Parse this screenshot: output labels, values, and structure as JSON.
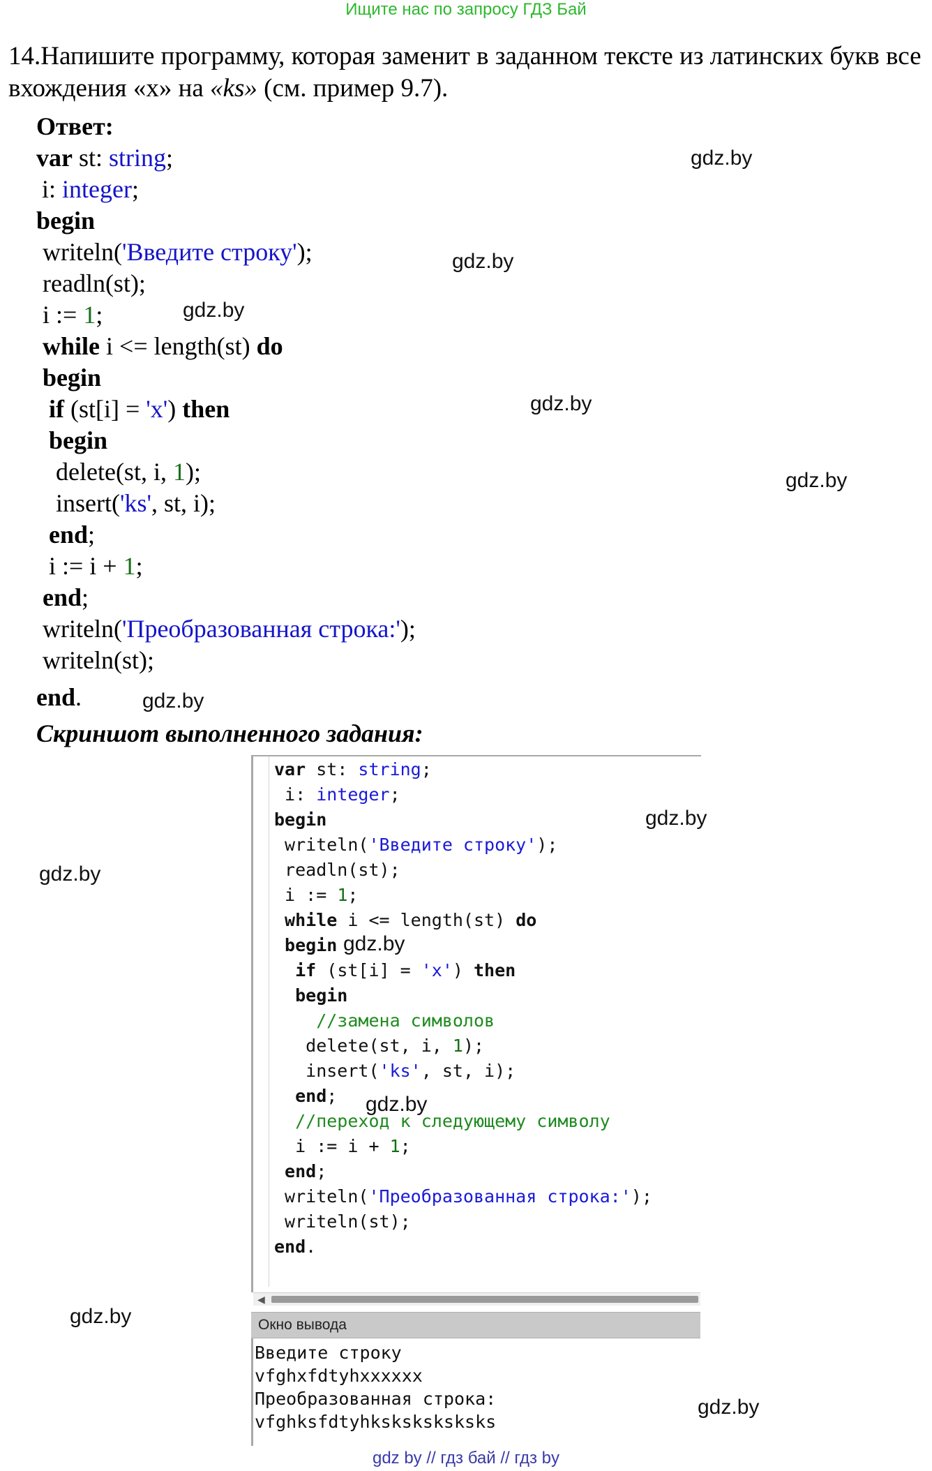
{
  "banner": "Ищите нас по запросу ГДЗ Бай",
  "task": {
    "part1": "14.Напишите программу, которая заменит в заданном тексте из латинских букв все вхождения «x» на ",
    "italic": "«ks»",
    "part2": " (см. пример 9.7)."
  },
  "answer_label": "Ответ:",
  "code": {
    "l1_kw": "var",
    "l1_rest": " st: ",
    "l1_type": "string",
    "l1_end": ";",
    "l2_rest": "i: ",
    "l2_type": "integer",
    "l2_end": ";",
    "l3_kw": "begin",
    "l4_a": "writeln(",
    "l4_str": "'Введите строку'",
    "l4_b": ");",
    "l5": "readln(st);",
    "l6_a": "i := ",
    "l6_num": "1",
    "l6_b": ";",
    "l7_kw1": "while",
    "l7_mid": " i <= length(st) ",
    "l7_kw2": "do",
    "l8_kw": "begin",
    "l9_kw1": "if",
    "l9_a": " (st[i] = ",
    "l9_str": "'x'",
    "l9_b": ") ",
    "l9_kw2": "then",
    "l10_kw": "begin",
    "l11_a": "delete(st, i, ",
    "l11_num": "1",
    "l11_b": ");",
    "l12_a": "insert(",
    "l12_str": "'ks'",
    "l12_b": ", st, i);",
    "l13_kw": "end",
    "l13_b": ";",
    "l14_a": "i := i + ",
    "l14_num": "1",
    "l14_b": ";",
    "l15_kw": "end",
    "l15_b": ";",
    "l16_a": "writeln(",
    "l16_str": "'Преобразованная строка:'",
    "l16_b": ");",
    "l17": "writeln(st);",
    "l18_kw": "end",
    "l18_b": "."
  },
  "screenshot_label": "Скриншот выполненного задания:",
  "ide": {
    "e1_kw": "var",
    "e1_a": " st: ",
    "e1_ty": "string",
    "e1_b": ";",
    "e2_a": " i: ",
    "e2_ty": "integer",
    "e2_b": ";",
    "e3_kw": "begin",
    "e4_a": " writeln(",
    "e4_st": "'Введите строку'",
    "e4_b": ");",
    "e5": " readln(st);",
    "e6_a": " i := ",
    "e6_nu": "1",
    "e6_b": ";",
    "e7_kw1": " while",
    "e7_a": " i <= length(st) ",
    "e7_kw2": "do",
    "e8_kw": " begin",
    "e9_kw1": "  if",
    "e9_a": " (st[i] = ",
    "e9_st": "'x'",
    "e9_b": ") ",
    "e9_kw2": "then",
    "e10_kw": "  begin",
    "e11_cm": "    //замена символов",
    "e12_a": "   delete(st, i, ",
    "e12_nu": "1",
    "e12_b": ");",
    "e13_a": "   insert(",
    "e13_st": "'ks'",
    "e13_b": ", st, i);",
    "e14_kw": "  end",
    "e14_b": ";",
    "e15_cm": "  //переход к следующему символу",
    "e16_a": "  i := i + ",
    "e16_nu": "1",
    "e16_b": ";",
    "e17_kw": " end",
    "e17_b": ";",
    "e18_a": " writeln(",
    "e18_st": "'Преобразованная строка:'",
    "e18_b": ");",
    "e19": " writeln(st);",
    "e20_kw": "end",
    "e20_b": ".",
    "output_title": "Окно вывода",
    "output_lines": [
      "Введите строку",
      "vfghxfdtyhxxxxxx",
      "Преобразованная строка:",
      "vfghksfdtyhksksksksksks"
    ]
  },
  "watermark": "gdz.by",
  "footer": "gdz by  //  гдз бай  //  гдз by"
}
